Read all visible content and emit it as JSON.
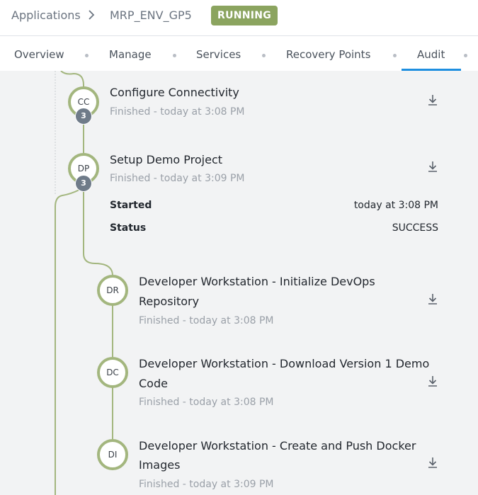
{
  "breadcrumb": {
    "root": "Applications",
    "separator": ">",
    "current": "MRP_ENV_GP5"
  },
  "status_badge": "RUNNING",
  "tabs": [
    {
      "label": "Overview"
    },
    {
      "label": "Manage"
    },
    {
      "label": "Services"
    },
    {
      "label": "Recovery Points"
    },
    {
      "label": "Audit",
      "active": true
    }
  ],
  "colors": {
    "accent": "#1e8fe0",
    "badge": "#8ba45f",
    "node_ring": "#a3b67e",
    "count_badge": "#6f7b89"
  },
  "tasks": [
    {
      "initials": "CC",
      "title": "Configure Connectivity",
      "status": "Finished - today at 3:08 PM",
      "count": "3"
    },
    {
      "initials": "DP",
      "title": "Setup Demo Project",
      "status": "Finished - today at 3:09 PM",
      "count": "3",
      "details": {
        "started_label": "Started",
        "started_value": "today at 3:08 PM",
        "status_label": "Status",
        "status_value": "SUCCESS"
      }
    },
    {
      "initials": "DR",
      "title_line1": "Developer Workstation - Initialize DevOps",
      "title_line2": "Repository",
      "status": "Finished - today at 3:08 PM"
    },
    {
      "initials": "DC",
      "title_line1": "Developer Workstation - Download Version 1 Demo",
      "title_line2": "Code",
      "status": "Finished - today at 3:08 PM"
    },
    {
      "initials": "DI",
      "title_line1": "Developer Workstation - Create and Push Docker",
      "title_line2": "Images",
      "status": "Finished - today at 3:09 PM"
    }
  ],
  "icons": {
    "download": "download-icon",
    "chevron": "chevron-right-icon"
  }
}
